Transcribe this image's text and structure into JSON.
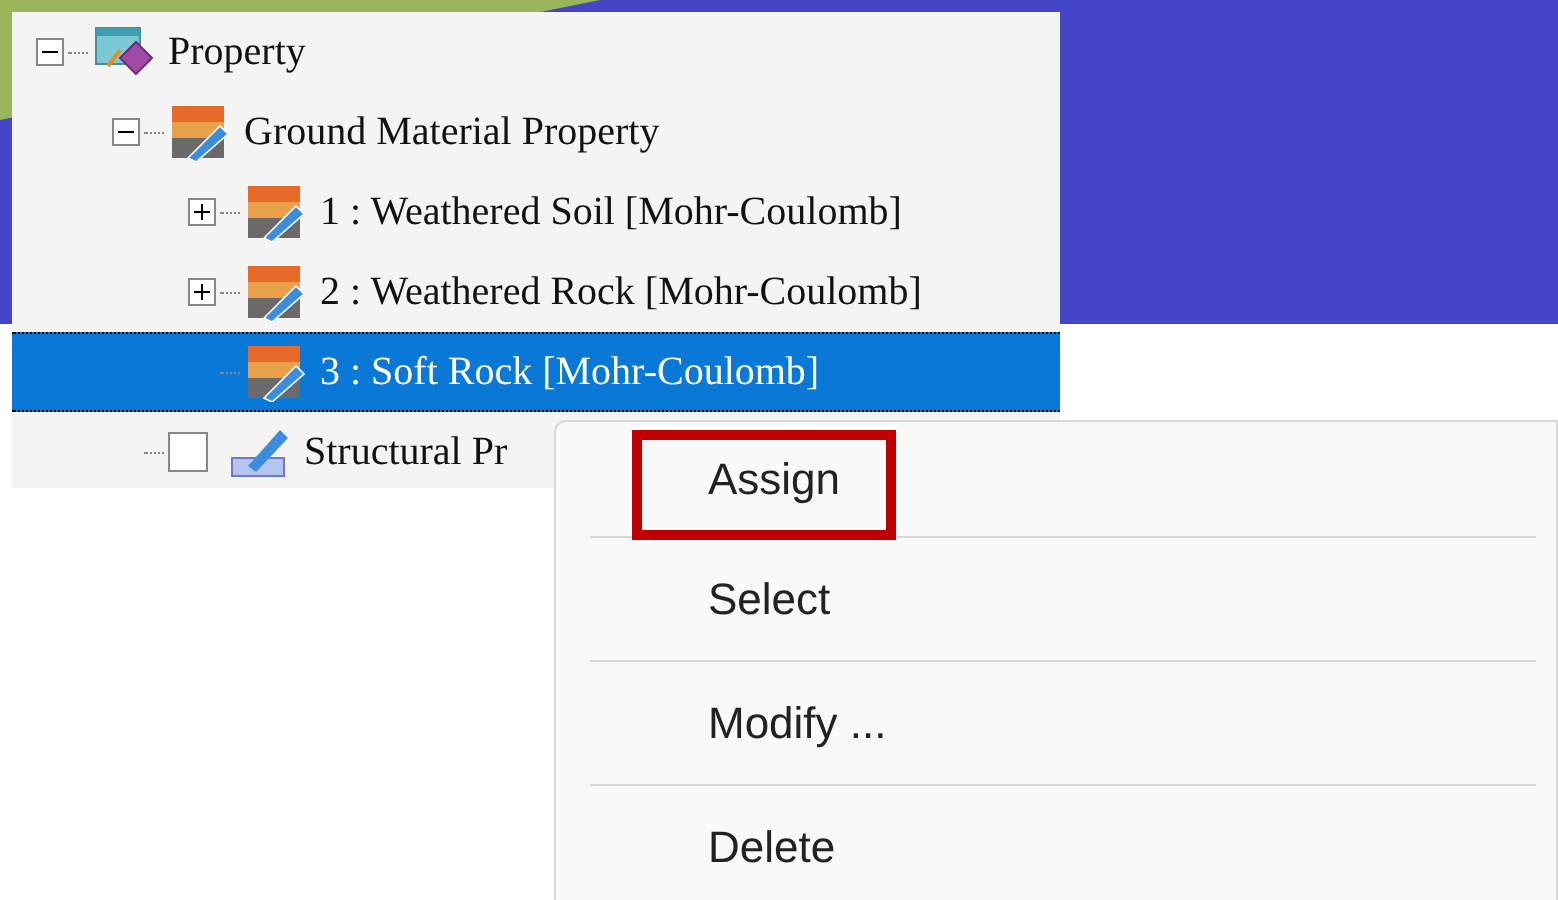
{
  "tree": [
    {
      "label": "Property",
      "kind": "root",
      "expanded": true,
      "selected": false,
      "children": [
        {
          "label": "Ground Material Property",
          "kind": "material",
          "expanded": true,
          "selected": false,
          "children": [
            {
              "label": "1 : Weathered Soil [Mohr-Coulomb]",
              "kind": "material",
              "expanded": false,
              "selected": false
            },
            {
              "label": "2 : Weathered Rock [Mohr-Coulomb]",
              "kind": "material",
              "expanded": false,
              "selected": false
            },
            {
              "label": "3 : Soft Rock [Mohr-Coulomb]",
              "kind": "material",
              "selected": true
            }
          ]
        },
        {
          "label": "Structural Pr",
          "kind": "structural",
          "checked": false,
          "selected": false
        }
      ]
    }
  ],
  "context_menu": [
    {
      "label": "Assign",
      "annotated": true
    },
    {
      "label": "Select",
      "annotated": false
    },
    {
      "label": "Modify ...",
      "annotated": false
    },
    {
      "label": "Delete",
      "annotated": false
    }
  ]
}
